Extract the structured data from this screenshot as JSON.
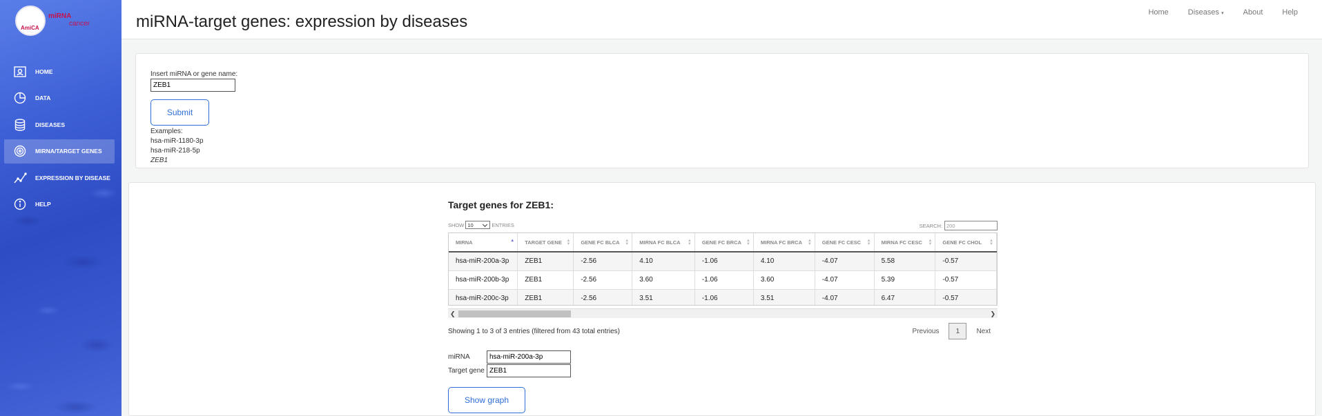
{
  "header": {
    "title": "miRNA-target genes: expression by diseases",
    "nav": [
      "Home",
      "Diseases",
      "About",
      "Help"
    ]
  },
  "logo": {
    "line1": "miRNA",
    "line2": "cancer",
    "mark": "AmiCA"
  },
  "sidebar": {
    "items": [
      {
        "label": "Home",
        "icon": "home-icon"
      },
      {
        "label": "Data",
        "icon": "pie-chart-icon"
      },
      {
        "label": "Diseases",
        "icon": "database-icon"
      },
      {
        "label": "miRNA/target genes",
        "icon": "target-icon"
      },
      {
        "label": "Expression by disease",
        "icon": "line-chart-icon"
      },
      {
        "label": "Help",
        "icon": "info-icon"
      }
    ],
    "active_index": 3
  },
  "query": {
    "label": "Insert miRNA or gene name:",
    "value": "ZEB1",
    "submit_label": "Submit",
    "examples_label": "Examples:",
    "examples": [
      "hsa-miR-1180-3p",
      "hsa-miR-218-5p",
      "ZEB1"
    ]
  },
  "results": {
    "title": "Target genes for ZEB1:",
    "show_label": "Show",
    "entries_value": "10",
    "entries_label": "entries",
    "search_label": "Search:",
    "search_value": "200",
    "columns": [
      "miRNA",
      "Target gene",
      "Gene FC BLCA",
      "miRNA FC BLCA",
      "Gene FC BRCA",
      "miRNA FC BRCA",
      "Gene FC CESC",
      "miRNA FC CESC",
      "Gene FC CHOL"
    ],
    "rows": [
      [
        "hsa-miR-200a-3p",
        "ZEB1",
        "-2.56",
        "4.10",
        "-1.06",
        "4.10",
        "-4.07",
        "5.58",
        "-0.57"
      ],
      [
        "hsa-miR-200b-3p",
        "ZEB1",
        "-2.56",
        "3.60",
        "-1.06",
        "3.60",
        "-4.07",
        "5.39",
        "-0.57"
      ],
      [
        "hsa-miR-200c-3p",
        "ZEB1",
        "-2.56",
        "3.51",
        "-1.06",
        "3.51",
        "-4.07",
        "6.47",
        "-0.57"
      ]
    ],
    "info": "Showing 1 to 3 of 3 entries (filtered from 43 total entries)",
    "pager": {
      "previous": "Previous",
      "current": "1",
      "next": "Next"
    }
  },
  "selection": {
    "mirna_label": "miRNA",
    "mirna_value": "hsa-miR-200a-3p",
    "gene_label": "Target gene",
    "gene_value": "ZEB1",
    "show_graph_label": "Show graph"
  },
  "colors": {
    "accent": "#2f6ed6",
    "sidebar": "#3d5fd6",
    "logo": "#c8104a"
  }
}
